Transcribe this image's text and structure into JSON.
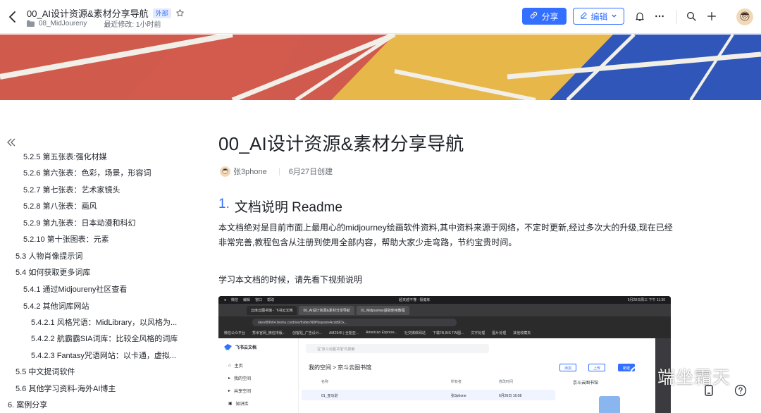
{
  "topbar": {
    "title": "00_AI设计资源&素材分享导航",
    "badge": "外部",
    "folder": "08_MidJoureny",
    "modified": "最近修改: 1小时前",
    "share_label": "分享",
    "edit_label": "编辑"
  },
  "toc": {
    "items": [
      {
        "label": "5.2.5 第五张表:强化材媒"
      },
      {
        "label": "5.2.6 第六张表：色彩，场景，形容词"
      },
      {
        "label": "5.2.7 第七张表：艺术家镜头"
      },
      {
        "label": "5.2.8 第八张表：画风"
      },
      {
        "label": "5.2.9 第九张表：日本动漫和科幻"
      },
      {
        "label": "5.2.10 第十张图表：元素"
      },
      {
        "label": "5.3 人物肖像提示词"
      },
      {
        "label": "5.4 如何获取更多词库"
      },
      {
        "label": "5.4.1 通过Midjoureny社区查看"
      },
      {
        "label": "5.4.2 其他词库网站"
      },
      {
        "label": "5.4.2.1 风格咒语：MidLibrary，以风格为..."
      },
      {
        "label": "5.4.2.2 航霸霸SIA词库：比较全风格的词库"
      },
      {
        "label": "5.4.2.3 Fantasy咒语网站：以卡通，虚拟..."
      },
      {
        "label": "5.5 中文提词软件"
      },
      {
        "label": "5.6 其他学习资料-海外AI博主"
      },
      {
        "label": "6. 案例分享"
      }
    ]
  },
  "doc": {
    "title": "00_AI设计资源&素材分享导航",
    "author": "张3phone",
    "created": "6月27日创建",
    "h1_num": "1.",
    "h1_text": "文档说明 Readme",
    "paragraph": "本文档绝对是目前市面上最用心的midjourney绘画软件资料,其中资料来源于网络，不定时更新,经过多次大的升级,现在已经非常完善,教程包含从注册到使用全部内容，帮助大家少走弯路，节约宝贵时间。",
    "paragraph2": "学习本文档的时候，请先看下视频说明"
  },
  "embed": {
    "menu": [
      "微信",
      "编辑",
      "窗口",
      "帮助"
    ],
    "center_title": "超夹越不懂 - 极健练",
    "clock": "6月28日周三 下午 11:30",
    "tabs": [
      "云库云图书馆 - 飞书云文档",
      "00_AI设计资源&素材分享导航",
      "01_Midjourney基础使用教程"
    ],
    "address": "skevt89hh4.feishu.cn/drive/folder/N8PfyqooireAcdd9Ox...",
    "bookmarks": [
      "微信公众平台",
      "秀米官网_微信排版...",
      "创客贴_广告设计...",
      "AMZ945 | 全能亚...",
      "American Express...",
      "社交媒体网站",
      "下载FB,INS TW图...",
      "文字处理",
      "图片处理",
      "其他收藏夹"
    ],
    "app_name": "飞书云文档",
    "search_placeholder": "在\"京斗云图书馆\"内搜索",
    "nav": [
      "主页",
      "我的空间",
      "共享空间",
      "知识库"
    ],
    "crumb": "我的空间  >  京斗云图书馆",
    "btn_add": "添加",
    "btn_upload": "上传",
    "btn_new": "新建",
    "col_name": "名称",
    "col_owner": "所有者",
    "col_modified": "修改时间",
    "row_name": "01_亚马逊",
    "row_owner": "张3phone",
    "row_date": "6月26日 16:08",
    "preview_title": "京斗云图书馆"
  },
  "watermark": "端坐霜天",
  "colors": {
    "accent": "#3370ff",
    "banner_red": "#d35b4e",
    "banner_yellow": "#e8b74a",
    "banner_blue": "#2f56b8"
  }
}
